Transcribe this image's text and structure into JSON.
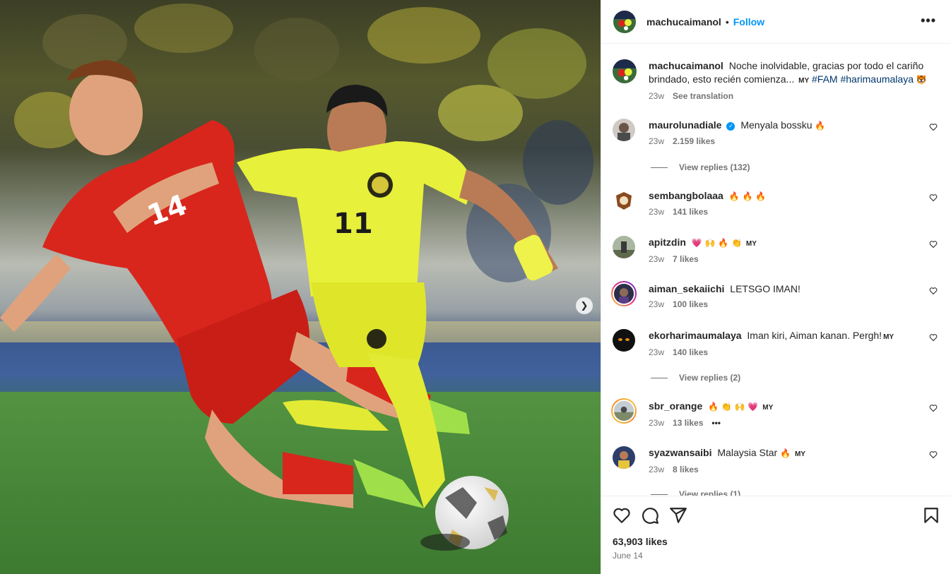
{
  "post": {
    "author": "machucaimanol",
    "separator": "•",
    "follow_label": "Follow",
    "more_icon": "more-horizontal-icon",
    "next_icon": "chevron-right-icon",
    "image_text": {
      "player_number_yellow": "11",
      "player_number_red": "14"
    }
  },
  "caption": {
    "username": "machucaimanol",
    "text": "Noche inolvidable, gracias por todo el cariño brindado, esto recién comienza...",
    "badge": "MY",
    "hashtag1": "#FAM",
    "hashtag2": "#harimaumalaya",
    "emoji": "🐯",
    "time": "23w",
    "see_translation": "See translation"
  },
  "comments": [
    {
      "username": "maurolunadiale",
      "verified": true,
      "text": "Menyala bossku",
      "emojis": "🔥",
      "badge": "",
      "time": "23w",
      "likes": "2.159 likes",
      "replies": "View replies (132)"
    },
    {
      "username": "sembangbolaaa",
      "verified": false,
      "text": "",
      "emojis": "🔥 🔥 🔥",
      "badge": "",
      "time": "23w",
      "likes": "141 likes",
      "replies": ""
    },
    {
      "username": "apitzdin",
      "verified": false,
      "text": "",
      "emojis": "💗 🙌 🔥 👏",
      "badge": "MY",
      "time": "23w",
      "likes": "7 likes",
      "replies": ""
    },
    {
      "username": "aiman_sekaiichi",
      "verified": false,
      "text": "LETSGO IMAN!",
      "emojis": "",
      "badge": "",
      "time": "23w",
      "likes": "100 likes",
      "replies": ""
    },
    {
      "username": "ekorharimaumalaya",
      "verified": false,
      "text": "Iman kiri, Aiman kanan. Pergh!",
      "emojis": "",
      "badge": "MY",
      "time": "23w",
      "likes": "140 likes",
      "replies": "View replies (2)"
    },
    {
      "username": "sbr_orange",
      "verified": false,
      "text": "",
      "emojis": "🔥 👏 🙌 💗",
      "badge": "MY",
      "time": "23w",
      "likes": "13 likes",
      "replies": "",
      "more": "•••"
    },
    {
      "username": "syazwansaibi",
      "verified": false,
      "text": "Malaysia Star",
      "emojis": "🔥",
      "badge": "MY",
      "time": "23w",
      "likes": "8 likes",
      "replies": "View replies (1)"
    }
  ],
  "footer": {
    "like_icon": "heart-icon",
    "comment_icon": "comment-icon",
    "share_icon": "send-icon",
    "save_icon": "bookmark-icon",
    "likes": "63,903 likes",
    "date": "June 14"
  },
  "colors": {
    "link": "#0095f6",
    "hashtag": "#00376b",
    "muted": "#737373",
    "verified": "#0095f6"
  }
}
